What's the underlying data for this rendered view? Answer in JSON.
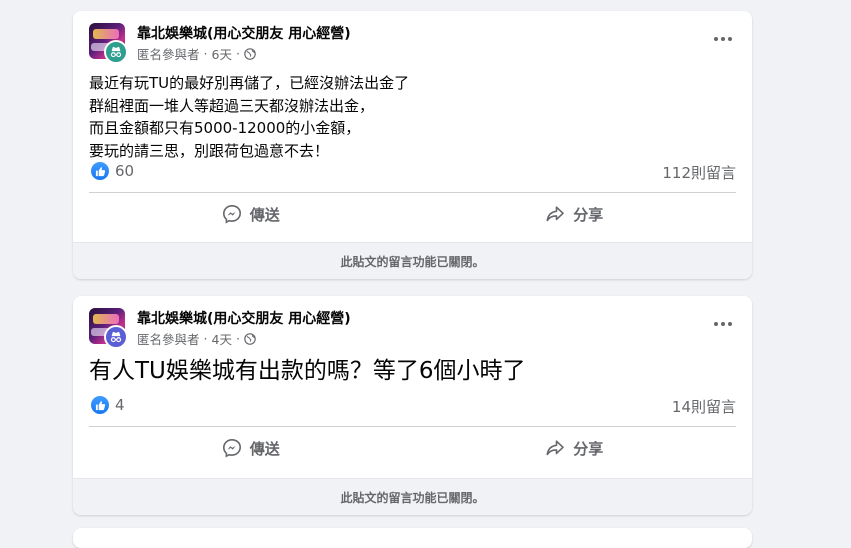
{
  "posts": [
    {
      "group_name": "靠北娛樂城(用心交朋友 用心經營)",
      "author": "匿名參與者",
      "time": "6天",
      "separator": "·",
      "badge_color": "#2e9f8f",
      "body": "最近有玩TU的最好別再儲了，已經沒辦法出金了\n群組裡面一堆人等超過三天都沒辦法出金，\n而且金額都只有5000-12000的小金額，\n要玩的請三思，別跟荷包過意不去！",
      "likes": "60",
      "comments": "112則留言",
      "send_label": "傳送",
      "share_label": "分享",
      "closed_notice": "此貼文的留言功能已關閉。"
    },
    {
      "group_name": "靠北娛樂城(用心交朋友 用心經營)",
      "author": "匿名參與者",
      "time": "4天",
      "separator": "·",
      "badge_color": "#5b5fd6",
      "body": "有人TU娛樂城有出款的嗎？等了6個小時了",
      "likes": "4",
      "comments": "14則留言",
      "send_label": "傳送",
      "share_label": "分享",
      "closed_notice": "此貼文的留言功能已關閉。"
    }
  ],
  "icons": {
    "like": "thumbs-up-icon",
    "send": "messenger-icon",
    "share": "share-arrow-icon",
    "privacy": "globe-icon",
    "more": "more-options-icon",
    "anonymous": "anonymous-incognito-icon"
  },
  "colors": {
    "background": "#f0f2f5",
    "card": "#ffffff",
    "secondary_text": "#65676b",
    "like_blue": "#1877f2"
  }
}
